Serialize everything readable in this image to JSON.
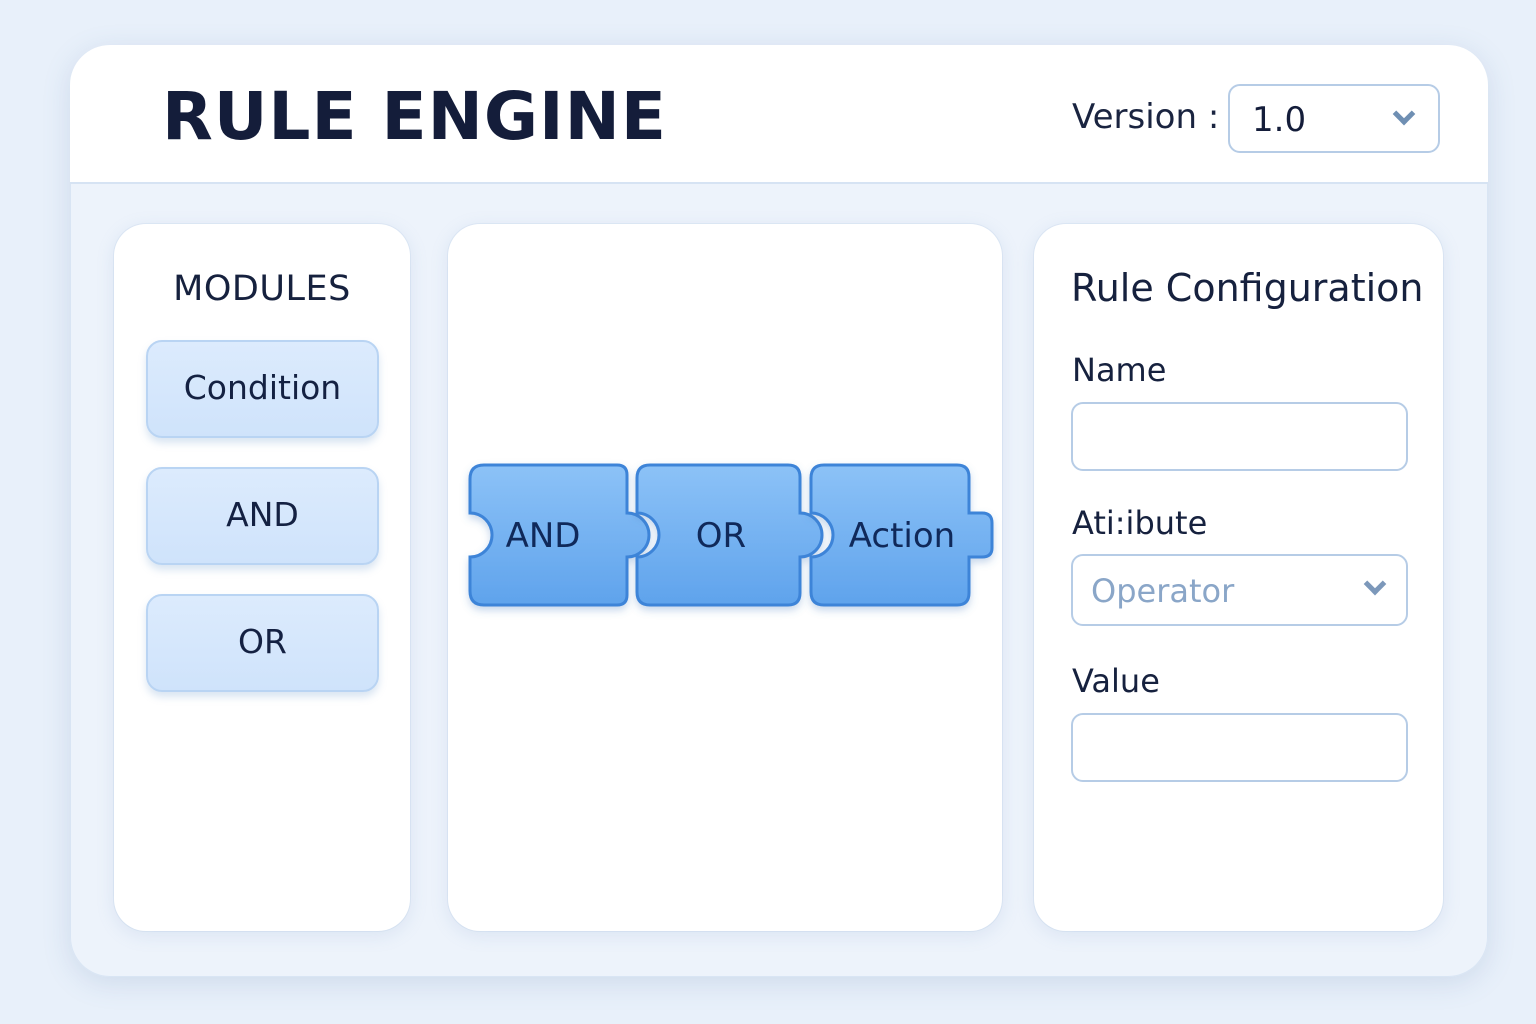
{
  "header": {
    "title": "RULE ENGINE",
    "version_label": "Version :",
    "version_value": "1.0"
  },
  "modules": {
    "title": "MODULES",
    "items": [
      {
        "label": "Condition"
      },
      {
        "label": "AND"
      },
      {
        "label": "OR"
      }
    ]
  },
  "canvas": {
    "blocks": [
      {
        "label": "AND"
      },
      {
        "label": "OR"
      },
      {
        "label": "Action"
      }
    ]
  },
  "config": {
    "title": "Rule Configuration",
    "name_label": "Name",
    "name_value": "",
    "attribute_label": "Ati:ibute",
    "operator_placeholder": "Operator",
    "value_label": "Value",
    "value_value": ""
  },
  "colors": {
    "accent": "#6aaef0",
    "block_border": "#3e84d8",
    "module_fill": "#d6e8fc",
    "background": "#e8f0fa"
  },
  "icons": {
    "version_dropdown": "chevron-down-icon",
    "operator_dropdown": "chevron-down-icon"
  }
}
